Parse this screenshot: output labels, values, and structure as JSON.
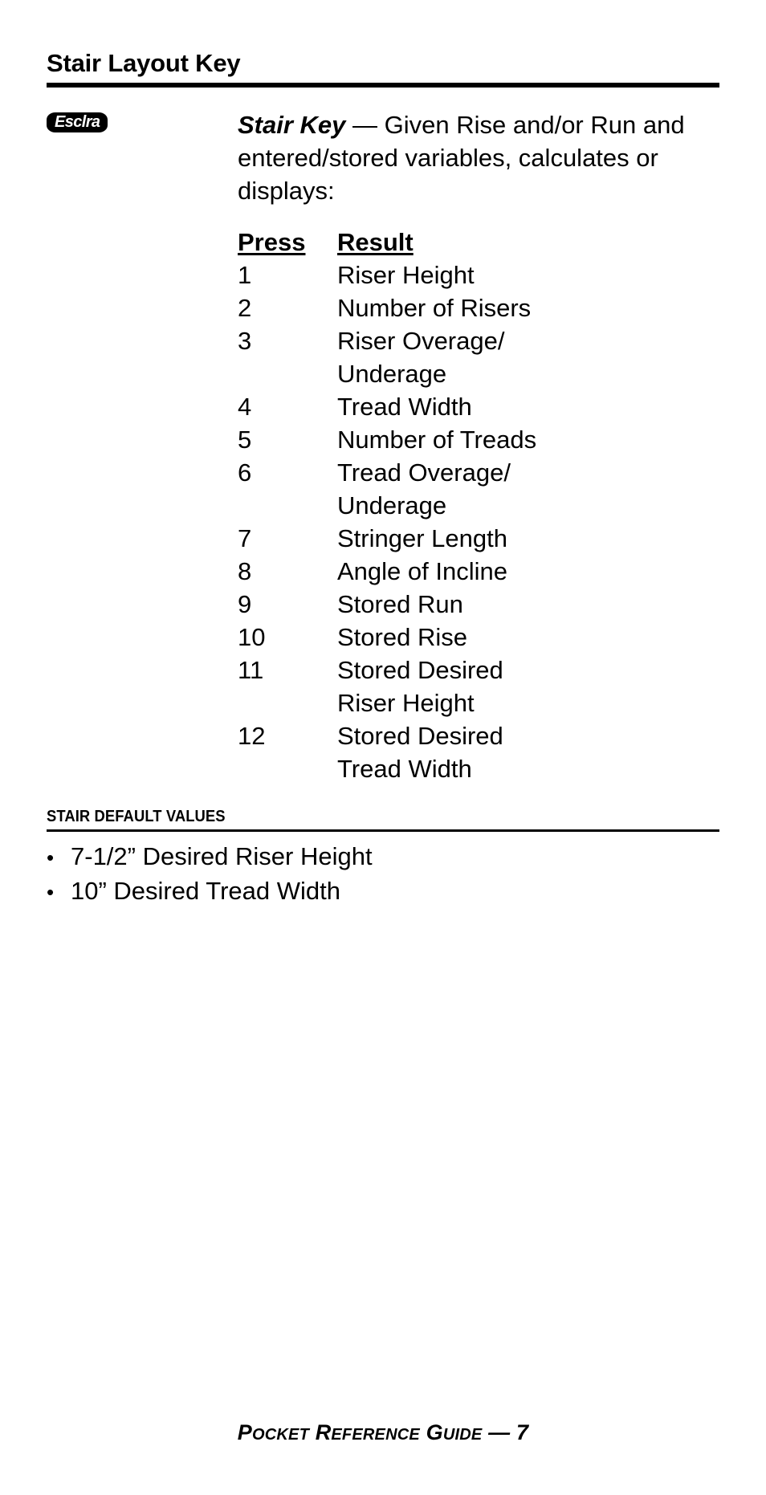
{
  "header": {
    "title": "Stair Layout Key"
  },
  "entry": {
    "badge_label": "Esclra",
    "key_name": "Stair Key",
    "description": " — Given Rise and/or Run and entered/stored variables, calculates or displays:"
  },
  "press_result_table": {
    "columns": {
      "press": "Press",
      "result": "Result"
    },
    "rows": [
      {
        "press": "1",
        "result": "Riser Height",
        "cont": ""
      },
      {
        "press": "2",
        "result": "Number of Risers",
        "cont": ""
      },
      {
        "press": "3",
        "result": "Riser Overage/",
        "cont": "Underage"
      },
      {
        "press": "4",
        "result": "Tread Width",
        "cont": ""
      },
      {
        "press": "5",
        "result": "Number of Treads",
        "cont": ""
      },
      {
        "press": "6",
        "result": "Tread Overage/",
        "cont": "Underage"
      },
      {
        "press": "7",
        "result": "Stringer Length",
        "cont": ""
      },
      {
        "press": "8",
        "result": "Angle of Incline",
        "cont": ""
      },
      {
        "press": "9",
        "result": "Stored Run",
        "cont": ""
      },
      {
        "press": "10",
        "result": "Stored Rise",
        "cont": ""
      },
      {
        "press": "11",
        "result": "Stored Desired",
        "cont": "Riser Height"
      },
      {
        "press": "12",
        "result": "Stored Desired",
        "cont": "Tread Width"
      }
    ]
  },
  "defaults_section": {
    "heading": "STAIR DEFAULT VALUES",
    "bullet_glyph": "•",
    "items": [
      "7-1/2” Desired Riser Height",
      "10” Desired Tread Width"
    ]
  },
  "footer": {
    "text_lead": "P",
    "text_1": "OCKET",
    "text_lead2": "R",
    "text_2": "EFERENCE",
    "text_lead3": "G",
    "text_3": "UIDE",
    "separator": " — ",
    "page_number": "7"
  }
}
